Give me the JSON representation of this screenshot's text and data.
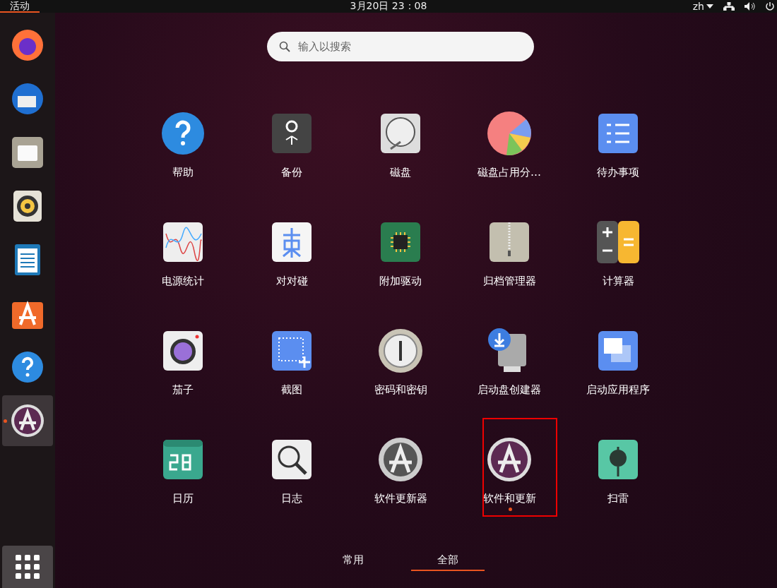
{
  "top_bar": {
    "activities": {
      "label": "活动",
      "selected": true
    },
    "clock": "3月20日  23：08",
    "language": "zh"
  },
  "dock": [
    {
      "running": false,
      "selected": false
    },
    {
      "running": false,
      "selected": false
    },
    {
      "running": false,
      "selected": false
    },
    {
      "running": false,
      "selected": false
    },
    {
      "running": false,
      "selected": false
    },
    {
      "running": false,
      "selected": false
    },
    {
      "running": false,
      "selected": false
    },
    {
      "running": true,
      "selected": true
    }
  ],
  "search": {
    "placeholder": "输入以搜索"
  },
  "apps": [
    {
      "label": "帮助",
      "running": false,
      "highlighted": false
    },
    {
      "label": "备份",
      "running": false,
      "highlighted": false
    },
    {
      "label": "磁盘",
      "running": false,
      "highlighted": false
    },
    {
      "label": "磁盘占用分…",
      "running": false,
      "highlighted": false
    },
    {
      "label": "待办事项",
      "running": false,
      "highlighted": false
    },
    {
      "label": "电源统计",
      "running": false,
      "highlighted": false
    },
    {
      "label": "对对碰",
      "running": false,
      "highlighted": false
    },
    {
      "label": "附加驱动",
      "running": false,
      "highlighted": false
    },
    {
      "label": "归档管理器",
      "running": false,
      "highlighted": false
    },
    {
      "label": "计算器",
      "running": false,
      "highlighted": false
    },
    {
      "label": "茄子",
      "running": false,
      "highlighted": false
    },
    {
      "label": "截图",
      "running": false,
      "highlighted": false
    },
    {
      "label": "密码和密钥",
      "running": false,
      "highlighted": false
    },
    {
      "label": "启动盘创建器",
      "running": false,
      "highlighted": false
    },
    {
      "label": "启动应用程序",
      "running": false,
      "highlighted": false
    },
    {
      "label": "日历",
      "running": false,
      "highlighted": false
    },
    {
      "label": "日志",
      "running": false,
      "highlighted": false
    },
    {
      "label": "软件更新器",
      "running": false,
      "highlighted": false
    },
    {
      "label": "软件和更新",
      "running": true,
      "highlighted": true
    },
    {
      "label": "扫雷",
      "running": false,
      "highlighted": false
    }
  ],
  "view_tabs": [
    {
      "label": "常用",
      "selected": false
    },
    {
      "label": "全部",
      "selected": true
    }
  ]
}
